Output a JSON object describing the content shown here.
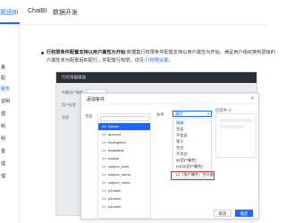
{
  "nav": {
    "tabs": [
      {
        "label": "观远BI",
        "active": true
      },
      {
        "label": "ChatBI",
        "active": false
      },
      {
        "label": "数据开发",
        "active": false
      }
    ]
  },
  "sidebar": {
    "items": [
      {
        "label": "量",
        "active": false
      },
      {
        "label": "配",
        "active": false
      },
      {
        "label": "服务",
        "active": true
      },
      {
        "label": "说明",
        "active": false
      },
      {
        "label": "理",
        "active": false
      },
      {
        "label": "制",
        "active": false
      },
      {
        "label": "明",
        "active": false
      },
      {
        "label": "置",
        "active": false
      },
      {
        "label": "理",
        "active": false
      },
      {
        "label": "理",
        "active": false
      }
    ]
  },
  "doc": {
    "bold_prefix": "行权限条件配置支持以用户属性为开始:",
    "line1_text": "数据集行权限条件配置支持以用户属性为开始，满足用户组织架构层级的",
    "line2_text": "户属性未为配置后匹配行，并配置行权限，详见:",
    "line2_link": "行权限设置",
    "line2_end": "。"
  },
  "bg_card": {
    "title": "行权限编辑器",
    "labels": [
      "所属用户属性",
      "用户标签",
      "字段"
    ]
  },
  "modal": {
    "title": "添加条件",
    "close": "✕",
    "field_label": "字段",
    "search_placeholder": "搜索",
    "fields": [
      {
        "type": "Ab",
        "name": "license",
        "selected": true
      },
      {
        "type": "Ab",
        "name": "account",
        "selected": false
      },
      {
        "type": "Ab",
        "name": "tradingtime",
        "selected": false
      },
      {
        "type": "Ab",
        "name": "tradetable",
        "selected": false
      },
      {
        "type": "Ab",
        "name": "tradeid",
        "selected": false
      },
      {
        "type": "Ab",
        "name": "subject_code",
        "selected": false
      },
      {
        "type": "Ab",
        "name": "subject_name",
        "selected": false
      },
      {
        "type": "Ab",
        "name": "subject_cnme",
        "selected": false
      },
      {
        "type": "Ab",
        "name": "p2name",
        "selected": false
      },
      {
        "type": "Ab",
        "name": "p3name",
        "selected": false
      },
      {
        "type": "Ab",
        "name": "p4name",
        "selected": false
      }
    ],
    "condition_label": "条件",
    "condition_value": "满足",
    "condition_options": [
      "精确",
      "包含",
      "不包含",
      "等于",
      "为空",
      "不为空",
      "in(用户属性)",
      "not in(用户属性)",
      "以（用户属性）为开始"
    ],
    "highlighted_option": "以（用户属性）为开始",
    "selected_label": "已选中: 0",
    "cancel": "取消",
    "confirm": "确定"
  }
}
